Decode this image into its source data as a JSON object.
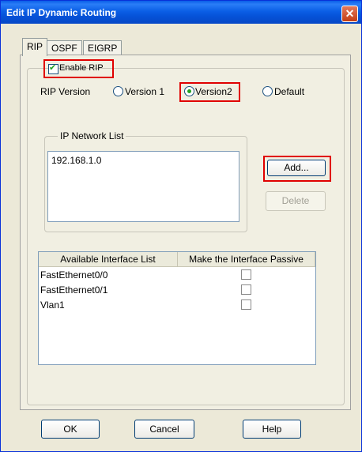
{
  "window": {
    "title": "Edit IP Dynamic Routing",
    "close_label": "✕"
  },
  "tabs": [
    {
      "label": "RIP",
      "active": true
    },
    {
      "label": "OSPF"
    },
    {
      "label": "EIGRP"
    }
  ],
  "rip": {
    "enable_label": "Enable RIP",
    "enabled": true,
    "version_label": "RIP Version",
    "versions": [
      {
        "label": "Version 1",
        "selected": false
      },
      {
        "label": "Version2",
        "selected": true
      },
      {
        "label": "Default",
        "selected": false
      }
    ]
  },
  "network_list": {
    "legend": "IP Network List",
    "items": [
      "192.168.1.0"
    ]
  },
  "buttons": {
    "add": "Add...",
    "delete": "Delete",
    "ok": "OK",
    "cancel": "Cancel",
    "help": "Help"
  },
  "interface_table": {
    "headers": [
      "Available Interface List",
      "Make the Interface Passive"
    ],
    "rows": [
      {
        "name": "FastEthernet0/0",
        "passive": false
      },
      {
        "name": "FastEthernet0/1",
        "passive": false
      },
      {
        "name": "Vlan1",
        "passive": false
      }
    ]
  },
  "colors": {
    "highlight": "#e00000",
    "titlebar": "#0a5ee8"
  }
}
